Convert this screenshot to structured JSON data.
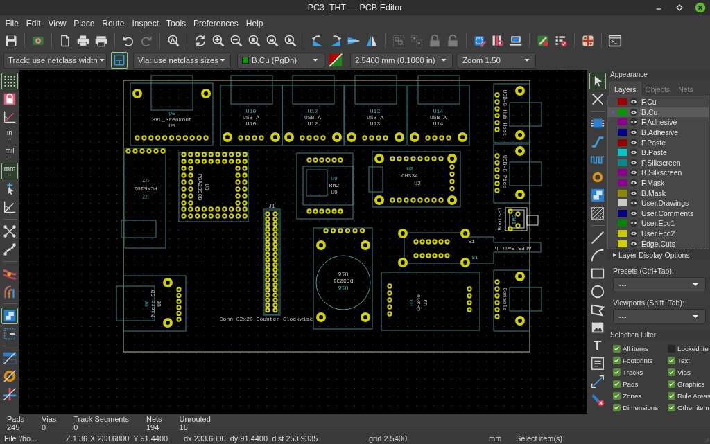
{
  "window": {
    "title": "PC3_THT — PCB Editor"
  },
  "menu": [
    "File",
    "Edit",
    "View",
    "Place",
    "Route",
    "Inspect",
    "Tools",
    "Preferences",
    "Help"
  ],
  "toolbar_buttons": [
    {
      "disabled": false
    },
    {
      "disabled": false
    },
    {
      "disabled": false
    },
    {
      "disabled": false
    },
    {
      "disabled": false
    },
    {
      "disabled": false
    },
    {
      "disabled": true
    },
    {
      "disabled": false
    },
    {
      "disabled": false
    },
    {
      "disabled": false
    },
    {
      "disabled": false
    },
    {
      "disabled": false
    },
    {
      "disabled": false
    },
    {
      "disabled": false
    },
    {
      "disabled": false
    },
    {
      "disabled": false
    },
    {
      "disabled": false
    },
    {
      "disabled": false
    },
    {
      "disabled": true
    },
    {
      "disabled": true
    },
    {
      "disabled": true
    },
    {
      "disabled": true
    },
    {
      "disabled": false
    },
    {
      "disabled": false
    },
    {
      "disabled": false
    },
    {
      "disabled": false
    },
    {
      "disabled": false
    },
    {
      "disabled": false
    },
    {
      "disabled": false
    }
  ],
  "options_bar": {
    "track_width": "Track: use netclass width",
    "auto_track_width": {
      "on": true
    },
    "via_size": "Via: use netclass sizes",
    "layer": "B.Cu (PgDn)",
    "grid": "2.5400 mm (0.1000 in)",
    "zoom": "Zoom 1.50"
  },
  "left_toolbar": [
    {
      "on": true
    },
    {
      "on": false
    },
    {
      "on": false
    },
    {
      "label": "in",
      "on": false
    },
    {
      "label": "mil",
      "on": false
    },
    {
      "label": "mm",
      "on": true
    },
    {
      "on": false
    },
    {
      "on": false
    },
    {
      "on": false
    },
    {
      "on": false
    },
    {
      "on": false
    },
    {
      "on": false
    },
    {
      "on": true
    },
    {
      "on": false
    },
    {
      "on": false
    },
    {
      "on": false
    },
    {
      "on": false
    }
  ],
  "right_toolbar": [
    {
      "on": true
    },
    {
      "on": false
    },
    {
      "on": false
    },
    {
      "on": false
    },
    {
      "on": false
    },
    {
      "on": false
    },
    {
      "on": false
    },
    {
      "on": false
    },
    {
      "on": false
    },
    {
      "on": false
    },
    {
      "on": false
    },
    {
      "on": false
    },
    {
      "on": false
    },
    {
      "on": false
    },
    {
      "label": "T",
      "on": false
    },
    {
      "on": false
    },
    {
      "on": false
    },
    {
      "on": false
    }
  ],
  "board": {
    "footprints": [
      {
        "labels": [
          "U5",
          "8VL_Breakout",
          "U5"
        ]
      },
      {
        "labels": [
          "U10",
          "USB-A",
          "U10"
        ]
      },
      {
        "labels": [
          "U12",
          "USB-A",
          "U12"
        ]
      },
      {
        "labels": [
          "U13",
          "USB-A",
          "U13"
        ]
      },
      {
        "labels": [
          "U14",
          "USB-A",
          "U14"
        ]
      },
      {
        "labels": [
          "U7",
          "PCM5102",
          "U7"
        ]
      },
      {
        "labels": [
          "U8",
          "PGA2350B"
        ]
      },
      {
        "labels": [
          "U9",
          "RM2",
          "U9"
        ]
      },
      {
        "labels": [
          "U2",
          "CH334",
          "U2"
        ]
      },
      {
        "labels": [
          "J1",
          "Conn_02x20_Counter_Clockwise"
        ]
      },
      {
        "labels": [
          "U16",
          "DS3231",
          "U16"
        ]
      },
      {
        "labels": [
          "U6",
          "Micro_SD",
          "U6"
        ]
      },
      {
        "labels": [
          "U3",
          "CH340",
          "U3"
        ]
      },
      {
        "labels": [
          "S1",
          "ALPS Switch",
          "S1"
        ]
      },
      {
        "labels": [
          "USB-C Hub Host"
        ]
      },
      {
        "labels": [
          "USB-C Pico"
        ]
      },
      {
        "labels": [
          "Bootsel",
          "SW1"
        ]
      },
      {
        "labels": [
          "Console"
        ]
      }
    ]
  },
  "appearance": {
    "title": "Appearance",
    "tabs": [
      {
        "label": "Layers",
        "selected": true
      },
      {
        "label": "Objects",
        "selected": false
      },
      {
        "label": "Nets",
        "selected": false
      }
    ],
    "layers": [
      {
        "name": "F.Cu",
        "color": "#9a0000",
        "visible": true,
        "selected": false
      },
      {
        "name": "B.Cu",
        "color": "#009a00",
        "visible": true,
        "selected": true
      },
      {
        "name": "F.Adhesive",
        "color": "#8a008a",
        "visible": true,
        "selected": false
      },
      {
        "name": "B.Adhesive",
        "color": "#00008a",
        "visible": true,
        "selected": false
      },
      {
        "name": "F.Paste",
        "color": "#980000",
        "visible": true,
        "selected": false
      },
      {
        "name": "B.Paste",
        "color": "#00c8c8",
        "visible": true,
        "selected": false
      },
      {
        "name": "F.Silkscreen",
        "color": "#008a8a",
        "visible": true,
        "selected": false
      },
      {
        "name": "B.Silkscreen",
        "color": "#880088",
        "visible": true,
        "selected": false
      },
      {
        "name": "F.Mask",
        "color": "#900090",
        "visible": true,
        "selected": false
      },
      {
        "name": "B.Mask",
        "color": "#8a8a00",
        "visible": true,
        "selected": false
      },
      {
        "name": "User.Drawings",
        "color": "#c8c8c8",
        "visible": true,
        "selected": false
      },
      {
        "name": "User.Comments",
        "color": "#000088",
        "visible": true,
        "selected": false
      },
      {
        "name": "User.Eco1",
        "color": "#008800",
        "visible": true,
        "selected": false
      },
      {
        "name": "User.Eco2",
        "color": "#c8c800",
        "visible": true,
        "selected": false
      },
      {
        "name": "Edge.Cuts",
        "color": "#d0d000",
        "visible": true,
        "selected": false
      }
    ],
    "layer_display_options": {
      "label": "Layer Display Options",
      "expanded": false
    },
    "presets": {
      "label": "Presets (Ctrl+Tab):",
      "value": "---"
    },
    "viewports": {
      "label": "Viewports (Shift+Tab):",
      "value": "---"
    }
  },
  "selection_filter": {
    "title": "Selection Filter",
    "items": [
      {
        "label": "All items",
        "checked": true
      },
      {
        "label": "Locked ite",
        "checked": false
      },
      {
        "label": "Footprints",
        "checked": true
      },
      {
        "label": "Text",
        "checked": true
      },
      {
        "label": "Tracks",
        "checked": true
      },
      {
        "label": "Vias",
        "checked": true
      },
      {
        "label": "Pads",
        "checked": true
      },
      {
        "label": "Graphics",
        "checked": true
      },
      {
        "label": "Zones",
        "checked": true
      },
      {
        "label": "Rule Areas",
        "checked": true
      },
      {
        "label": "Dimensions",
        "checked": true
      },
      {
        "label": "Other item",
        "checked": true
      }
    ]
  },
  "message_panel": [
    {
      "label": "Pads",
      "value": "245"
    },
    {
      "label": "Vias",
      "value": "0"
    },
    {
      "label": "Track Segments",
      "value": "0"
    },
    {
      "label": "Nets",
      "value": "194"
    },
    {
      "label": "Unrouted",
      "value": "18"
    }
  ],
  "status_bar": [
    "File '/ho...",
    "Z 1.36",
    "X 233.6800  Y 91.4400",
    "dx 233.6800  dy 91.4400  dist 250.9335",
    "grid 2.5400",
    "mm",
    "Select item(s)"
  ]
}
